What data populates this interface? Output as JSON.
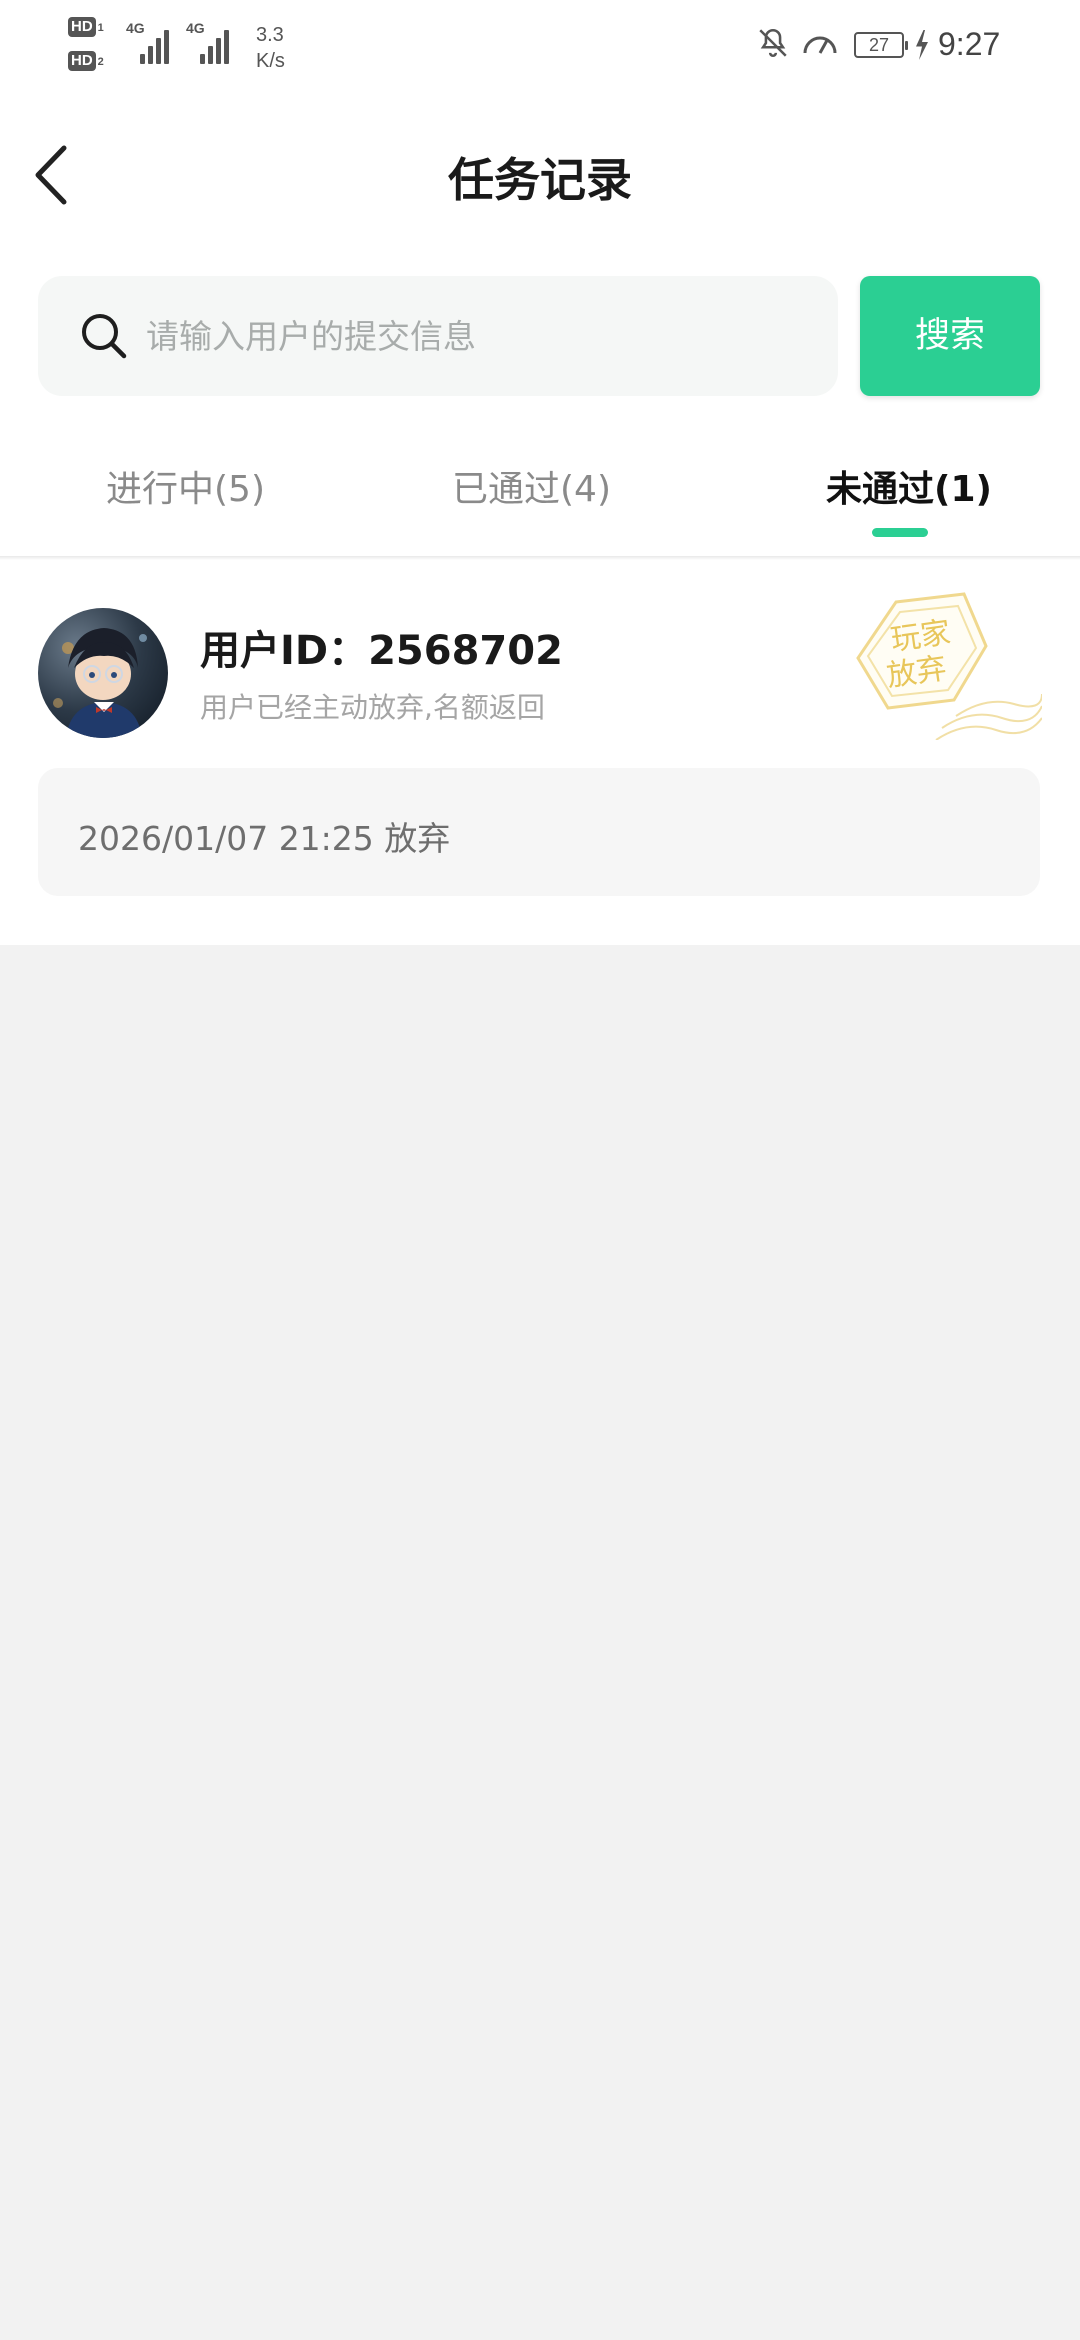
{
  "status_bar": {
    "sim1_label": "HD",
    "sim1_num": "1",
    "sim2_label": "HD",
    "sim2_num": "2",
    "network1": "4G",
    "network2": "4G",
    "speed_value": "3.3",
    "speed_unit": "K/s",
    "battery": "27",
    "time": "9:27"
  },
  "header": {
    "title": "任务记录"
  },
  "search": {
    "placeholder": "请输入用户的提交信息",
    "value": "",
    "button_label": "搜索"
  },
  "tabs": [
    {
      "label": "进行中(5)",
      "active": false
    },
    {
      "label": "已通过(4)",
      "active": false
    },
    {
      "label": "未通过(1)",
      "active": true
    }
  ],
  "colors": {
    "accent": "#2bcf93",
    "stamp": "#e8c65a"
  },
  "record": {
    "user_id": "用户ID：2568702",
    "description": "用户已经主动放弃,名额返回",
    "stamp_line1": "玩家",
    "stamp_line2": "放弃",
    "timestamp": "2026/01/07 21:25 放弃"
  }
}
